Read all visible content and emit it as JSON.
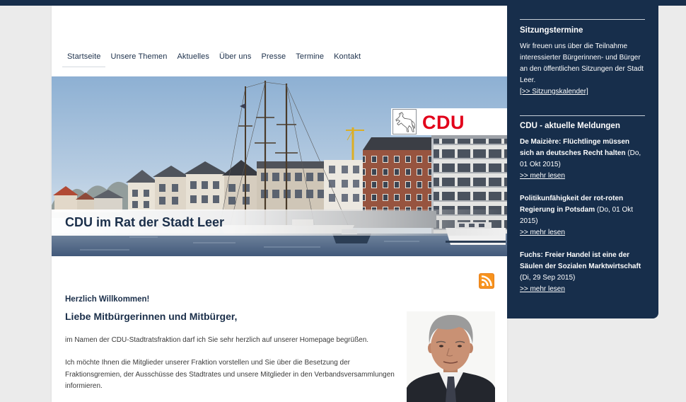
{
  "nav": {
    "items": [
      {
        "label": "Startseite",
        "active": true
      },
      {
        "label": "Unsere Themen"
      },
      {
        "label": "Aktuelles"
      },
      {
        "label": "Über uns"
      },
      {
        "label": "Presse"
      },
      {
        "label": "Termine"
      },
      {
        "label": "Kontakt"
      }
    ]
  },
  "header": {
    "logo_text": "CDU",
    "logo_emblem": "horse-emblem-icon",
    "banner_title": "CDU im Rat der Stadt Leer"
  },
  "content": {
    "rss_icon": "rss-icon",
    "greeting": "Herzlich Willkommen!",
    "salutation": "Liebe Mitbürgerinnen und Mitbürger,",
    "paragraphs": [
      "im Namen der CDU-Stadtratsfraktion darf ich Sie sehr herzlich auf unserer Homepage begrüßen.",
      "Ich möchte Ihnen die Mitglieder unserer Fraktion vorstellen und Sie über die Besetzung der Fraktionsgremien, der Ausschüsse des Stadtrates und unsere Mitglieder in den Verbandsversammlungen informieren."
    ]
  },
  "sidebar": {
    "sessions": {
      "heading": "Sitzungstermine",
      "text": "Wir freuen uns über die Teilnahme interessierter Bürgerinnen- und Bürger an den öffentlichen Sitzungen der Stadt Leer.",
      "link": "[>> Sitzungskalender]"
    },
    "news": {
      "heading": "CDU - aktuelle Meldungen",
      "items": [
        {
          "title": "De Maizière: Flüchtlinge müssen sich an deutsches Recht halten",
          "date": "(Do, 01 Okt 2015)",
          "more": ">> mehr lesen"
        },
        {
          "title": "Politikunfähigkeit der rot-roten Regierung in Potsdam",
          "date": "(Do, 01 Okt 2015)",
          "more": ">> mehr lesen"
        },
        {
          "title": "Fuchs: Freier Handel ist eine der Säulen der Sozialen Marktwirtschaft",
          "date": "(Di, 29 Sep 2015)",
          "more": ">> mehr lesen"
        }
      ]
    }
  },
  "colors": {
    "navy": "#172e4b",
    "cdu_red": "#e2001a",
    "rss_orange": "#f7931e",
    "page_background": "#ebebeb",
    "content_background": "#ffffff"
  }
}
